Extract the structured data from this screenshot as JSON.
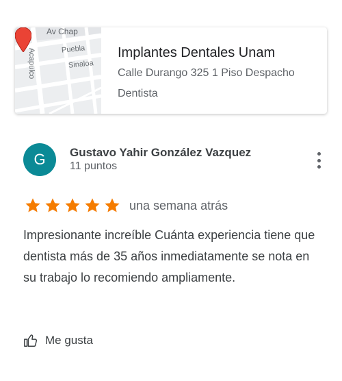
{
  "place": {
    "map_labels": {
      "street_top": "Av Chap",
      "street_puebla": "Puebla",
      "street_sinaloa": "Sinaloa",
      "street_acapulco": "Acapulco"
    },
    "pin_color": "#ea4335",
    "name": "Implantes Dentales Unam",
    "address": "Calle Durango 325 1 Piso Despacho",
    "category": "Dentista"
  },
  "review": {
    "avatar_letter": "G",
    "avatar_color": "#0b8a96",
    "author": "Gustavo Yahir González Vazquez",
    "points": "11 puntos",
    "rating": 5,
    "rating_max": 5,
    "star_color": "#f57c00",
    "time": "una semana atrás",
    "text": "Impresionante increíble Cuánta experiencia tiene que dentista más de 35 años inmediatamente se nota en su trabajo lo recomiendo ampliamente.",
    "more_icon": "more-vert-icon"
  },
  "actions": {
    "like_label": "Me gusta",
    "like_icon": "thumb-up-icon"
  }
}
